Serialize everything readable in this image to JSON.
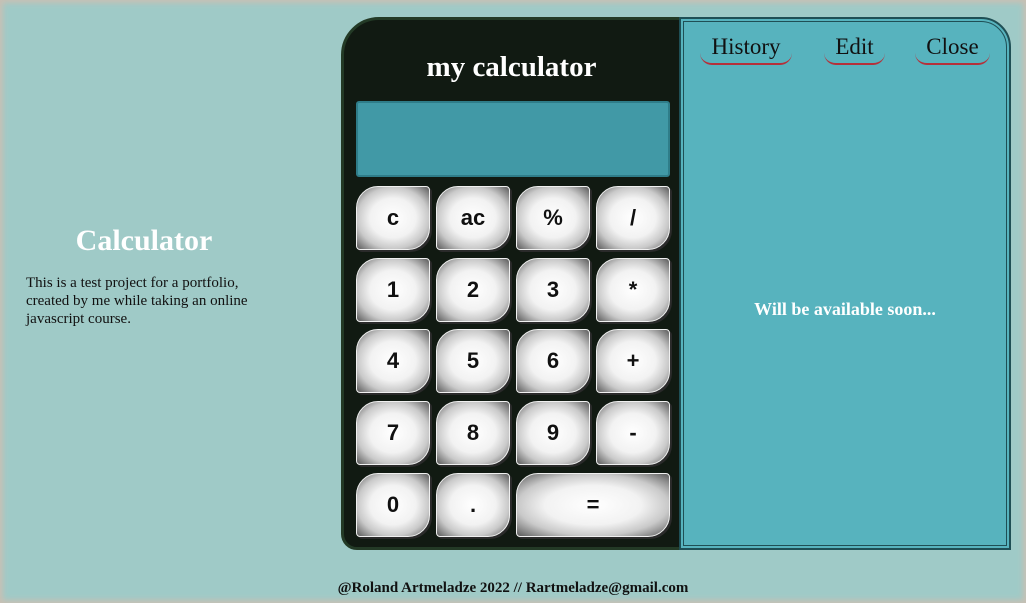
{
  "intro": {
    "title": "Calculator",
    "description": "This is a test project for a portfolio, created by me while taking an online javascript course."
  },
  "calculator": {
    "title": "my calculator",
    "display_value": "",
    "keys": [
      "c",
      "ac",
      "%",
      "/",
      "1",
      "2",
      "3",
      "*",
      "4",
      "5",
      "6",
      "+",
      "7",
      "8",
      "9",
      "-",
      "0",
      ".",
      "="
    ]
  },
  "panel": {
    "tabs": [
      "History",
      "Edit",
      "Close"
    ],
    "message": "Will be available soon..."
  },
  "footer": "@Roland Artmeladze 2022 // Rartmeladze@gmail.com"
}
